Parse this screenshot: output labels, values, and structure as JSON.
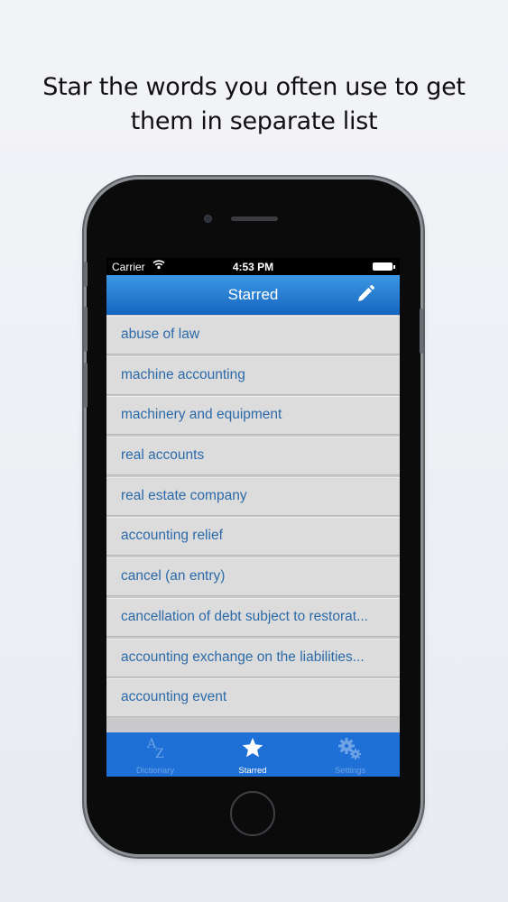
{
  "promo": {
    "line1": "Star the words you often use to get",
    "line2": "them in separate list"
  },
  "statusbar": {
    "carrier": "Carrier",
    "wifi_icon": "wifi-icon",
    "time": "4:53 PM",
    "battery_icon": "battery-icon"
  },
  "navbar": {
    "title": "Starred",
    "edit_icon": "pencil-icon",
    "color": "#1e74d3"
  },
  "starred_words": [
    "abuse of law",
    "machine accounting",
    "machinery and equipment",
    "real accounts",
    "real estate company",
    "accounting relief",
    "cancel (an entry)",
    "cancellation of debt subject to restorat...",
    "accounting exchange on the liabilities...",
    "accounting event"
  ],
  "tabbar": {
    "tabs": [
      {
        "label": "Dictionary",
        "icon": "az-icon",
        "active": false
      },
      {
        "label": "Starred",
        "icon": "star-icon",
        "active": true
      },
      {
        "label": "Settings",
        "icon": "gears-icon",
        "active": false
      }
    ]
  }
}
